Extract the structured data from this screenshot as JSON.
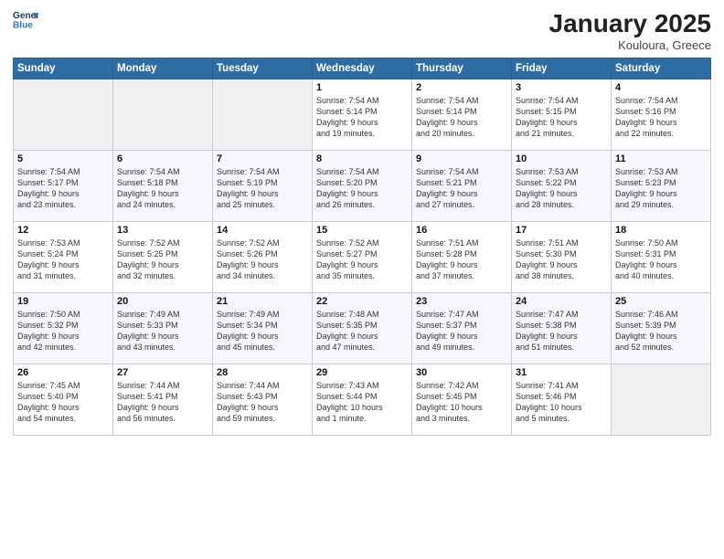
{
  "logo": {
    "line1": "General",
    "line2": "Blue"
  },
  "title": "January 2025",
  "location": "Kouloura, Greece",
  "days_of_week": [
    "Sunday",
    "Monday",
    "Tuesday",
    "Wednesday",
    "Thursday",
    "Friday",
    "Saturday"
  ],
  "weeks": [
    [
      {
        "day": "",
        "info": ""
      },
      {
        "day": "",
        "info": ""
      },
      {
        "day": "",
        "info": ""
      },
      {
        "day": "1",
        "info": "Sunrise: 7:54 AM\nSunset: 5:14 PM\nDaylight: 9 hours\nand 19 minutes."
      },
      {
        "day": "2",
        "info": "Sunrise: 7:54 AM\nSunset: 5:14 PM\nDaylight: 9 hours\nand 20 minutes."
      },
      {
        "day": "3",
        "info": "Sunrise: 7:54 AM\nSunset: 5:15 PM\nDaylight: 9 hours\nand 21 minutes."
      },
      {
        "day": "4",
        "info": "Sunrise: 7:54 AM\nSunset: 5:16 PM\nDaylight: 9 hours\nand 22 minutes."
      }
    ],
    [
      {
        "day": "5",
        "info": "Sunrise: 7:54 AM\nSunset: 5:17 PM\nDaylight: 9 hours\nand 23 minutes."
      },
      {
        "day": "6",
        "info": "Sunrise: 7:54 AM\nSunset: 5:18 PM\nDaylight: 9 hours\nand 24 minutes."
      },
      {
        "day": "7",
        "info": "Sunrise: 7:54 AM\nSunset: 5:19 PM\nDaylight: 9 hours\nand 25 minutes."
      },
      {
        "day": "8",
        "info": "Sunrise: 7:54 AM\nSunset: 5:20 PM\nDaylight: 9 hours\nand 26 minutes."
      },
      {
        "day": "9",
        "info": "Sunrise: 7:54 AM\nSunset: 5:21 PM\nDaylight: 9 hours\nand 27 minutes."
      },
      {
        "day": "10",
        "info": "Sunrise: 7:53 AM\nSunset: 5:22 PM\nDaylight: 9 hours\nand 28 minutes."
      },
      {
        "day": "11",
        "info": "Sunrise: 7:53 AM\nSunset: 5:23 PM\nDaylight: 9 hours\nand 29 minutes."
      }
    ],
    [
      {
        "day": "12",
        "info": "Sunrise: 7:53 AM\nSunset: 5:24 PM\nDaylight: 9 hours\nand 31 minutes."
      },
      {
        "day": "13",
        "info": "Sunrise: 7:52 AM\nSunset: 5:25 PM\nDaylight: 9 hours\nand 32 minutes."
      },
      {
        "day": "14",
        "info": "Sunrise: 7:52 AM\nSunset: 5:26 PM\nDaylight: 9 hours\nand 34 minutes."
      },
      {
        "day": "15",
        "info": "Sunrise: 7:52 AM\nSunset: 5:27 PM\nDaylight: 9 hours\nand 35 minutes."
      },
      {
        "day": "16",
        "info": "Sunrise: 7:51 AM\nSunset: 5:28 PM\nDaylight: 9 hours\nand 37 minutes."
      },
      {
        "day": "17",
        "info": "Sunrise: 7:51 AM\nSunset: 5:30 PM\nDaylight: 9 hours\nand 38 minutes."
      },
      {
        "day": "18",
        "info": "Sunrise: 7:50 AM\nSunset: 5:31 PM\nDaylight: 9 hours\nand 40 minutes."
      }
    ],
    [
      {
        "day": "19",
        "info": "Sunrise: 7:50 AM\nSunset: 5:32 PM\nDaylight: 9 hours\nand 42 minutes."
      },
      {
        "day": "20",
        "info": "Sunrise: 7:49 AM\nSunset: 5:33 PM\nDaylight: 9 hours\nand 43 minutes."
      },
      {
        "day": "21",
        "info": "Sunrise: 7:49 AM\nSunset: 5:34 PM\nDaylight: 9 hours\nand 45 minutes."
      },
      {
        "day": "22",
        "info": "Sunrise: 7:48 AM\nSunset: 5:35 PM\nDaylight: 9 hours\nand 47 minutes."
      },
      {
        "day": "23",
        "info": "Sunrise: 7:47 AM\nSunset: 5:37 PM\nDaylight: 9 hours\nand 49 minutes."
      },
      {
        "day": "24",
        "info": "Sunrise: 7:47 AM\nSunset: 5:38 PM\nDaylight: 9 hours\nand 51 minutes."
      },
      {
        "day": "25",
        "info": "Sunrise: 7:46 AM\nSunset: 5:39 PM\nDaylight: 9 hours\nand 52 minutes."
      }
    ],
    [
      {
        "day": "26",
        "info": "Sunrise: 7:45 AM\nSunset: 5:40 PM\nDaylight: 9 hours\nand 54 minutes."
      },
      {
        "day": "27",
        "info": "Sunrise: 7:44 AM\nSunset: 5:41 PM\nDaylight: 9 hours\nand 56 minutes."
      },
      {
        "day": "28",
        "info": "Sunrise: 7:44 AM\nSunset: 5:43 PM\nDaylight: 9 hours\nand 59 minutes."
      },
      {
        "day": "29",
        "info": "Sunrise: 7:43 AM\nSunset: 5:44 PM\nDaylight: 10 hours\nand 1 minute."
      },
      {
        "day": "30",
        "info": "Sunrise: 7:42 AM\nSunset: 5:45 PM\nDaylight: 10 hours\nand 3 minutes."
      },
      {
        "day": "31",
        "info": "Sunrise: 7:41 AM\nSunset: 5:46 PM\nDaylight: 10 hours\nand 5 minutes."
      },
      {
        "day": "",
        "info": ""
      }
    ]
  ]
}
